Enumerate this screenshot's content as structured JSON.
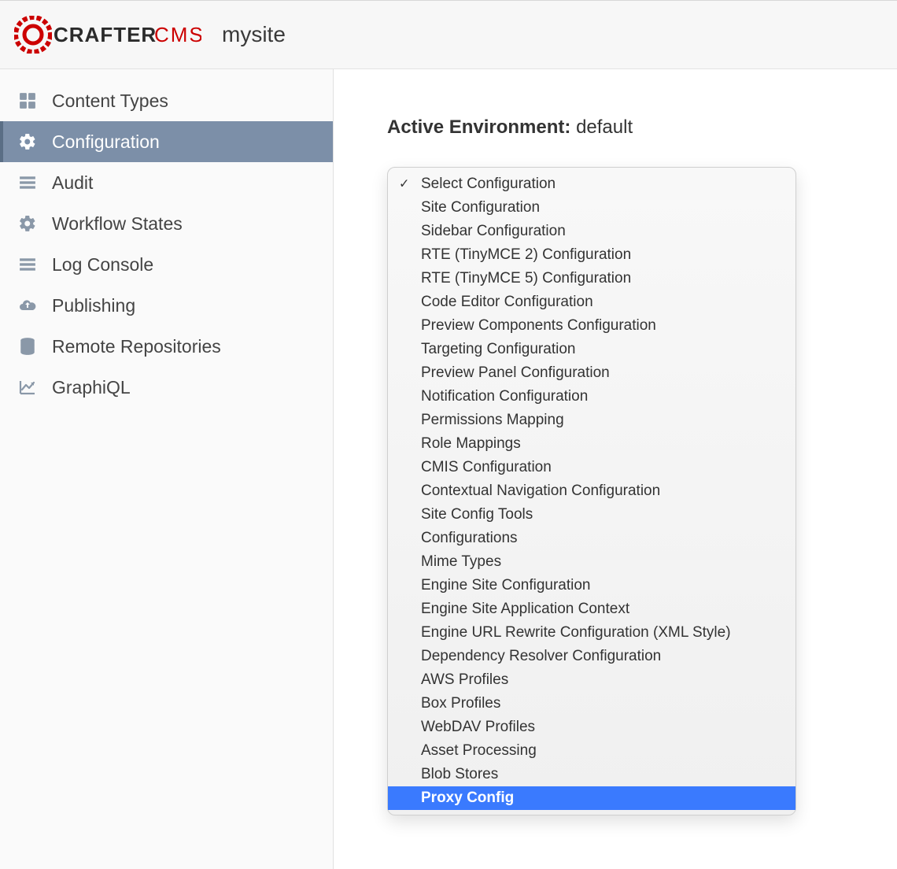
{
  "header": {
    "brand_crafter": "CRAFTER",
    "brand_cms": "CMS",
    "site_name": "mysite"
  },
  "sidebar": {
    "items": [
      {
        "label": "Content Types",
        "icon": "grid-icon",
        "selected": false
      },
      {
        "label": "Configuration",
        "icon": "gear-icon",
        "selected": true
      },
      {
        "label": "Audit",
        "icon": "list-icon",
        "selected": false
      },
      {
        "label": "Workflow States",
        "icon": "gear-icon",
        "selected": false
      },
      {
        "label": "Log Console",
        "icon": "list-icon",
        "selected": false
      },
      {
        "label": "Publishing",
        "icon": "cloud-up-icon",
        "selected": false
      },
      {
        "label": "Remote Repositories",
        "icon": "database-icon",
        "selected": false
      },
      {
        "label": "GraphiQL",
        "icon": "chart-icon",
        "selected": false
      }
    ]
  },
  "main": {
    "env_label": "Active Environment:",
    "env_value": "default",
    "dropdown": {
      "options": [
        {
          "label": "Select Configuration",
          "checked": true,
          "highlight": false
        },
        {
          "label": "Site Configuration",
          "checked": false,
          "highlight": false
        },
        {
          "label": "Sidebar Configuration",
          "checked": false,
          "highlight": false
        },
        {
          "label": "RTE (TinyMCE 2) Configuration",
          "checked": false,
          "highlight": false
        },
        {
          "label": "RTE (TinyMCE 5) Configuration",
          "checked": false,
          "highlight": false
        },
        {
          "label": "Code Editor Configuration",
          "checked": false,
          "highlight": false
        },
        {
          "label": "Preview Components Configuration",
          "checked": false,
          "highlight": false
        },
        {
          "label": "Targeting Configuration",
          "checked": false,
          "highlight": false
        },
        {
          "label": "Preview Panel Configuration",
          "checked": false,
          "highlight": false
        },
        {
          "label": "Notification Configuration",
          "checked": false,
          "highlight": false
        },
        {
          "label": "Permissions Mapping",
          "checked": false,
          "highlight": false
        },
        {
          "label": "Role Mappings",
          "checked": false,
          "highlight": false
        },
        {
          "label": "CMIS Configuration",
          "checked": false,
          "highlight": false
        },
        {
          "label": "Contextual Navigation Configuration",
          "checked": false,
          "highlight": false
        },
        {
          "label": "Site Config Tools",
          "checked": false,
          "highlight": false
        },
        {
          "label": "Configurations",
          "checked": false,
          "highlight": false
        },
        {
          "label": "Mime Types",
          "checked": false,
          "highlight": false
        },
        {
          "label": "Engine Site Configuration",
          "checked": false,
          "highlight": false
        },
        {
          "label": "Engine Site Application Context",
          "checked": false,
          "highlight": false
        },
        {
          "label": "Engine URL Rewrite Configuration (XML Style)",
          "checked": false,
          "highlight": false
        },
        {
          "label": "Dependency Resolver Configuration",
          "checked": false,
          "highlight": false
        },
        {
          "label": "AWS Profiles",
          "checked": false,
          "highlight": false
        },
        {
          "label": "Box Profiles",
          "checked": false,
          "highlight": false
        },
        {
          "label": "WebDAV Profiles",
          "checked": false,
          "highlight": false
        },
        {
          "label": "Asset Processing",
          "checked": false,
          "highlight": false
        },
        {
          "label": "Blob Stores",
          "checked": false,
          "highlight": false
        },
        {
          "label": "Proxy Config",
          "checked": false,
          "highlight": true
        }
      ]
    }
  }
}
